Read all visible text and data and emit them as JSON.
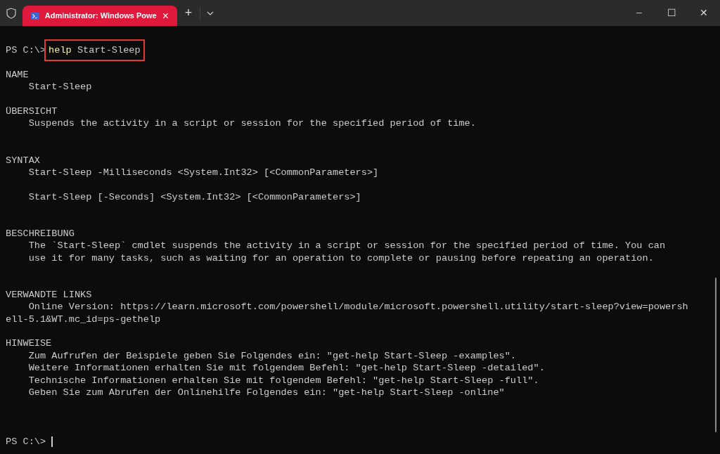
{
  "tab": {
    "title": "Administrator: Windows Powe",
    "selected": true,
    "close": "×"
  },
  "new_tab": "+",
  "window_controls": {
    "minimize": "─",
    "maximize": "☐",
    "close": "✕"
  },
  "command": {
    "prompt": "PS C:\\>",
    "name": "help",
    "argument": "Start-Sleep",
    "highlighted": true
  },
  "output": [
    {
      "kind": "line",
      "text": "NAME"
    },
    {
      "kind": "line",
      "text": "    Start-Sleep"
    },
    {
      "kind": "blank"
    },
    {
      "kind": "line",
      "text": "ÜBERSICHT"
    },
    {
      "kind": "line",
      "text": "    Suspends the activity in a script or session for the specified period of time."
    },
    {
      "kind": "blank"
    },
    {
      "kind": "blank"
    },
    {
      "kind": "line",
      "text": "SYNTAX"
    },
    {
      "kind": "line",
      "text": "    Start-Sleep -Milliseconds <System.Int32> [<CommonParameters>]"
    },
    {
      "kind": "blank"
    },
    {
      "kind": "line",
      "text": "    Start-Sleep [-Seconds] <System.Int32> [<CommonParameters>]"
    },
    {
      "kind": "blank"
    },
    {
      "kind": "blank"
    },
    {
      "kind": "line",
      "text": "BESCHREIBUNG"
    },
    {
      "kind": "line",
      "text": "    The `Start-Sleep` cmdlet suspends the activity in a script or session for the specified period of time. You can"
    },
    {
      "kind": "line",
      "text": "    use it for many tasks, such as waiting for an operation to complete or pausing before repeating an operation."
    },
    {
      "kind": "blank"
    },
    {
      "kind": "blank"
    },
    {
      "kind": "line",
      "text": "VERWANDTE LINKS"
    },
    {
      "kind": "line",
      "text": "    Online Version: https://learn.microsoft.com/powershell/module/microsoft.powershell.utility/start-sleep?view=powersh"
    },
    {
      "kind": "line",
      "text": "ell-5.1&WT.mc_id=ps-gethelp"
    },
    {
      "kind": "blank"
    },
    {
      "kind": "line",
      "text": "HINWEISE"
    },
    {
      "kind": "line",
      "text": "    Zum Aufrufen der Beispiele geben Sie Folgendes ein: \"get-help Start-Sleep -examples\"."
    },
    {
      "kind": "line",
      "text": "    Weitere Informationen erhalten Sie mit folgendem Befehl: \"get-help Start-Sleep -detailed\"."
    },
    {
      "kind": "line",
      "text": "    Technische Informationen erhalten Sie mit folgendem Befehl: \"get-help Start-Sleep -full\"."
    },
    {
      "kind": "line",
      "text": "    Geben Sie zum Abrufen der Onlinehilfe Folgendes ein: \"get-help Start-Sleep -online\""
    },
    {
      "kind": "blank"
    },
    {
      "kind": "blank"
    },
    {
      "kind": "blank"
    }
  ],
  "final_prompt": "PS C:\\>"
}
